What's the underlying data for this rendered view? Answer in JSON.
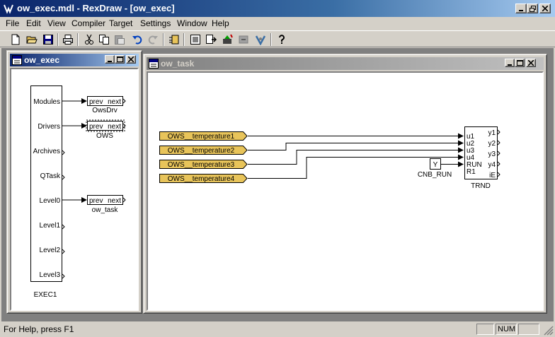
{
  "window": {
    "title": "ow_exec.mdl - RexDraw - [ow_exec]"
  },
  "menu": [
    "File",
    "Edit",
    "View",
    "Compiler",
    "Target",
    "Settings",
    "Window",
    "Help"
  ],
  "toolbar": {
    "icons": [
      "new-file-icon",
      "open-folder-icon",
      "save-icon",
      "print-icon",
      "cut-icon",
      "copy-icon",
      "paste-icon",
      "undo-icon",
      "redo-icon",
      "block-library-icon",
      "compile-icon",
      "download-icon",
      "connect-icon",
      "disconnect-icon",
      "watch-icon",
      "help-icon"
    ]
  },
  "exec_window": {
    "title": "ow_exec",
    "block": {
      "name": "EXEC1",
      "ports": [
        "Modules",
        "Drivers",
        "Archives",
        "QTask",
        "Level0",
        "Level1",
        "Level2",
        "Level3"
      ]
    },
    "sub_blocks": [
      {
        "prev": "prev",
        "next": "next",
        "name": "OwsDrv"
      },
      {
        "prev": "prev",
        "next": "next",
        "name": "OWS"
      },
      {
        "prev": "prev",
        "next": "next",
        "name": "ow_task"
      }
    ]
  },
  "task_window": {
    "title": "ow_task",
    "inputs": [
      "OWS__temperature1",
      "OWS__temperature2",
      "OWS__temperature3",
      "OWS__temperature4"
    ],
    "const_block": {
      "value": "Y",
      "name": "CNB_RUN"
    },
    "trend_block": {
      "name": "TRND",
      "inputs": [
        "u1",
        "u2",
        "u3",
        "u4",
        "RUN",
        "R1"
      ],
      "outputs": [
        "y1",
        "y2",
        "y3",
        "y4",
        "iE"
      ]
    }
  },
  "statusbar": {
    "help_text": "For Help, press F1",
    "num_indicator": "NUM"
  },
  "colors": {
    "title_active": "#0a246a",
    "title_gradient_end": "#a6caf0",
    "input_block_fill": "#e8c45a",
    "face": "#d4d0c8"
  }
}
